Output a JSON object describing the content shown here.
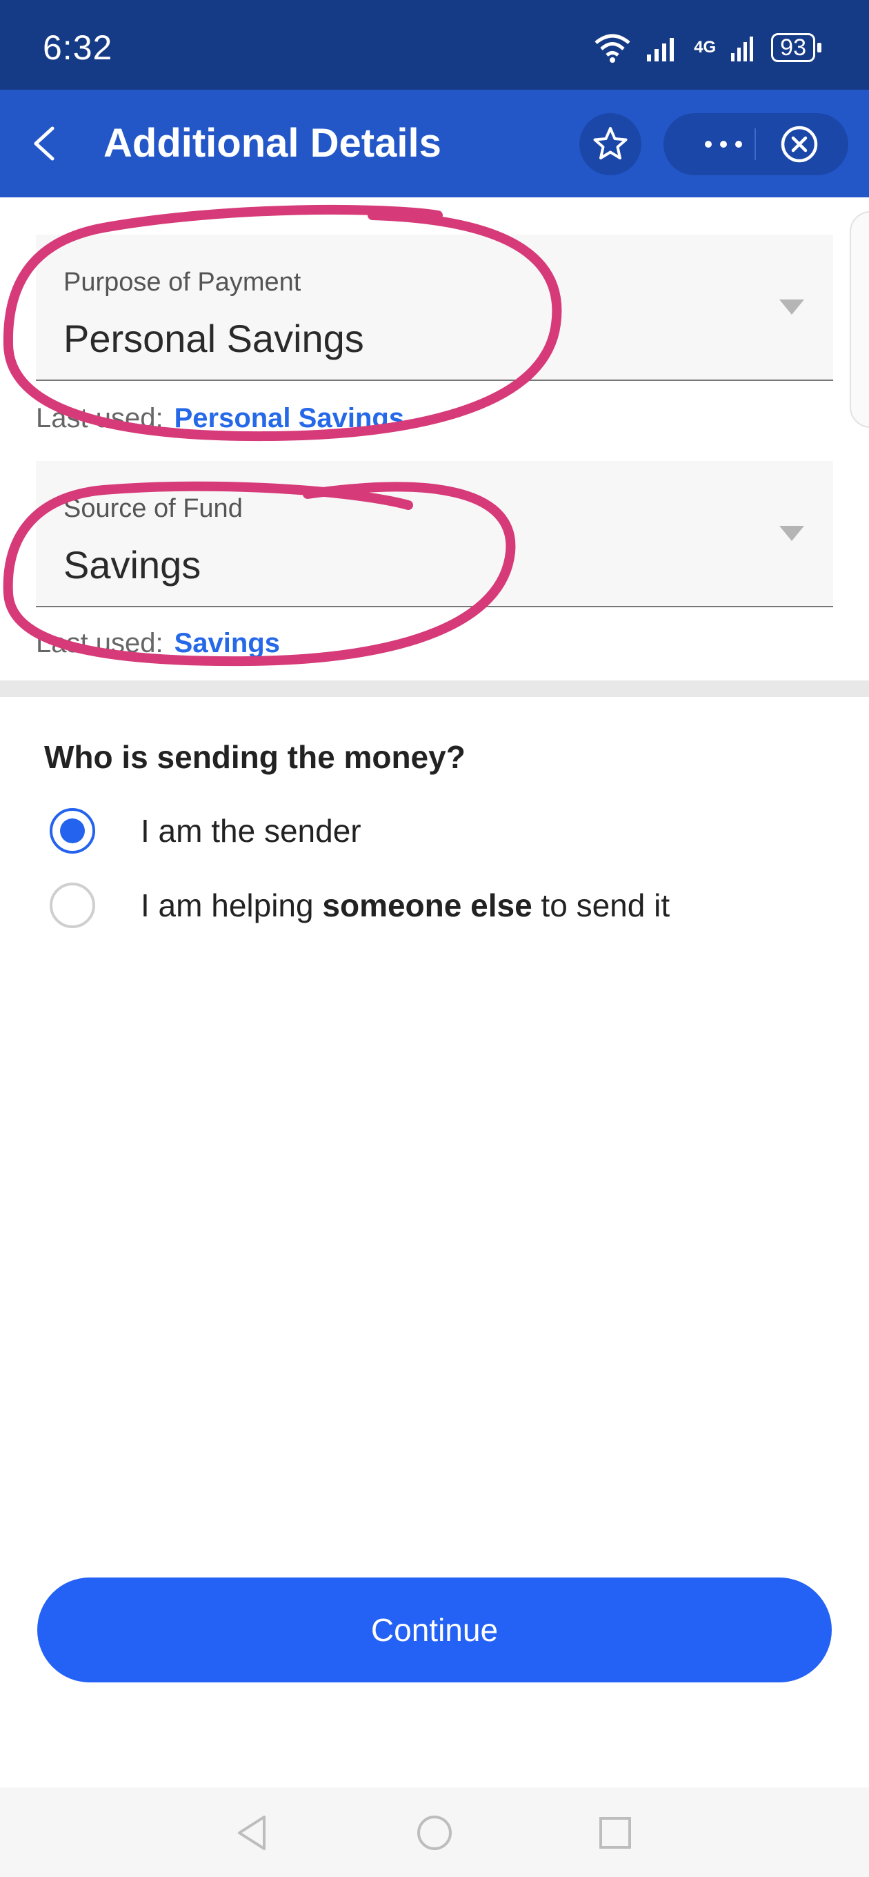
{
  "status_bar": {
    "time": "6:32",
    "network": "4G",
    "battery": "93"
  },
  "header": {
    "title": "Additional Details",
    "back_icon": "chevron-left-icon",
    "favorite_icon": "star-icon",
    "more_icon": "more-icon",
    "close_icon": "close-circle-icon"
  },
  "form": {
    "purpose": {
      "label": "Purpose of Payment",
      "value": "Personal Savings",
      "last_used_label": "Last used:",
      "last_used_value": "Personal Savings"
    },
    "source": {
      "label": "Source of Fund",
      "value": "Savings",
      "last_used_label": "Last used:",
      "last_used_value": "Savings"
    }
  },
  "sender": {
    "question": "Who is sending the money?",
    "options": [
      {
        "label": "I am the sender",
        "selected": true
      },
      {
        "label_pre": "I am helping ",
        "label_bold": "someone else",
        "label_post": " to send it",
        "selected": false
      }
    ]
  },
  "continue_label": "Continue",
  "colors": {
    "status_bar": "#163b86",
    "header": "#2357c8",
    "accent": "#2461f5",
    "link": "#2568e8",
    "annotation": "#d63a78"
  }
}
